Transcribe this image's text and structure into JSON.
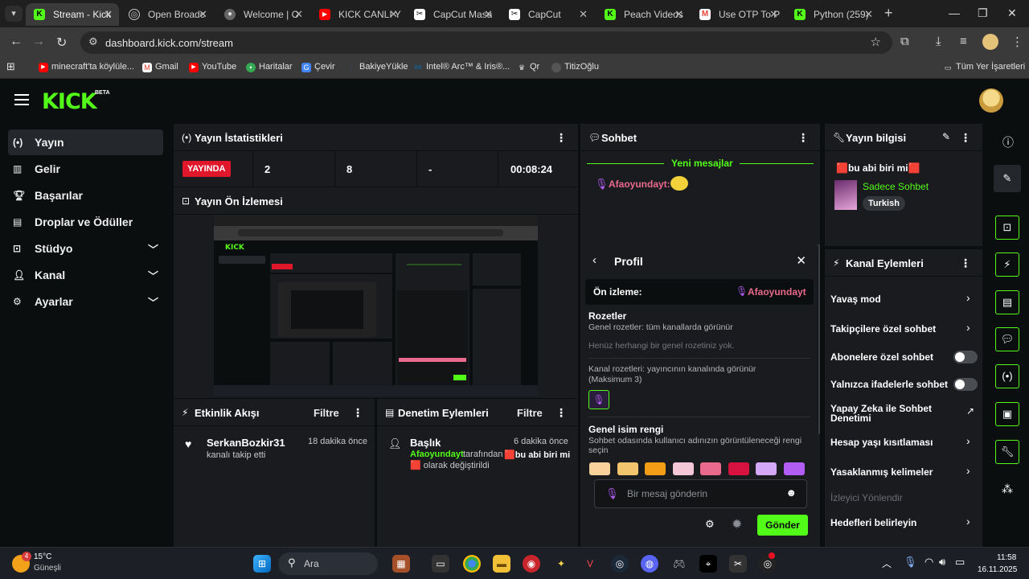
{
  "browser": {
    "tabs": [
      {
        "label": "Stream - Kick",
        "active": true,
        "icon": "kick-icon",
        "color": "#53fc18"
      },
      {
        "label": "Open Broadc",
        "active": false,
        "icon": "obs-icon",
        "color": "#cccccc"
      },
      {
        "label": "Welcome | O",
        "active": false,
        "icon": "globe-icon",
        "color": "#cccccc"
      },
      {
        "label": "KICK CANLI Y",
        "active": false,
        "icon": "youtube-icon",
        "color": "#ff0000"
      },
      {
        "label": "CapCut Masa",
        "active": false,
        "icon": "capcut-icon",
        "color": "#ffffff"
      },
      {
        "label": "CapCut",
        "active": false,
        "icon": "capcut-icon",
        "color": "#ffffff"
      },
      {
        "label": "Peach Videos",
        "active": false,
        "icon": "kick-icon",
        "color": "#53fc18"
      },
      {
        "label": "Use OTP To P",
        "active": false,
        "icon": "gmail-icon",
        "color": "#ea4335"
      },
      {
        "label": "Python (259)",
        "active": false,
        "icon": "kick-icon",
        "color": "#53fc18"
      }
    ],
    "url": "dashboard.kick.com/stream",
    "bookmarks": [
      {
        "label": "minecraft'ta köylüle...",
        "icon": "youtube-icon",
        "color": "#ff0000"
      },
      {
        "label": "Gmail",
        "icon": "gmail-icon",
        "color": "#ea4335"
      },
      {
        "label": "YouTube",
        "icon": "youtube-icon",
        "color": "#ff0000"
      },
      {
        "label": "Haritalar",
        "icon": "maps-icon",
        "color": "#34a853"
      },
      {
        "label": "Çevir",
        "icon": "translate-icon",
        "color": "#4285f4"
      },
      {
        "label": "BakiyeYükle",
        "icon": "bakiye-icon",
        "color": "#3d5afe"
      },
      {
        "label": "Intel® Arc™ & Iris®...",
        "icon": "intel-icon",
        "color": "#0071c5"
      },
      {
        "label": "Qr",
        "icon": "crown-icon",
        "color": "#dddddd"
      },
      {
        "label": "TitizOğlu",
        "icon": "globe-icon",
        "color": "#888888"
      }
    ],
    "all_bookmarks": "Tüm Yer İşaretleri"
  },
  "kick": {
    "logo": "KICK",
    "beta": "BETA",
    "nav": [
      {
        "label": "Yayın",
        "icon": "broadcast-icon",
        "active": true,
        "chevron": false
      },
      {
        "label": "Gelir",
        "icon": "chart-icon",
        "active": false,
        "chevron": false
      },
      {
        "label": "Başarılar",
        "icon": "trophy-icon",
        "active": false,
        "chevron": false
      },
      {
        "label": "Droplar ve Ödüller",
        "icon": "gift-icon",
        "active": false,
        "chevron": false
      },
      {
        "label": "Stüdyo",
        "icon": "studio-icon",
        "active": false,
        "chevron": true
      },
      {
        "label": "Kanal",
        "icon": "person-icon",
        "active": false,
        "chevron": true
      },
      {
        "label": "Ayarlar",
        "icon": "gear-icon",
        "active": false,
        "chevron": true
      }
    ],
    "stats": {
      "title": "Yayın İstatistikleri",
      "live": "YAYINDA",
      "viewers": "2",
      "followers": "8",
      "subs": "-",
      "duration": "00:08:24"
    },
    "preview": {
      "title": "Yayın Ön İzlemesi"
    },
    "activity": {
      "title": "Etkinlik Akışı",
      "filter": "Filtre",
      "items": [
        {
          "name": "SerkanBozkir31",
          "text": "kanalı takip etti",
          "time": "18 dakika önce"
        }
      ]
    },
    "moderation": {
      "title": "Denetim Eylemleri",
      "filter": "Filtre",
      "items": [
        {
          "title": "Başlık",
          "time": "6 dakika önce",
          "user": "Afaoyundayt",
          "text1": "tarafından",
          "value": "🟥bu abi biri mi",
          "text2": "🟥 olarak değiştirildi"
        }
      ]
    },
    "chat": {
      "title": "Sohbet",
      "new_messages": "Yeni mesajlar",
      "message_user": "Afaoyundayt:",
      "input_placeholder": "Bir mesaj gönderin",
      "send": "Gönder",
      "profile": {
        "title": "Profil",
        "preview_label": "Ön izleme:",
        "preview_name": "Afaoyundayt",
        "badges_title": "Rozetler",
        "global_badges": "Genel rozetler: tüm kanallarda görünür",
        "no_global": "Henüz herhangi bir genel rozetiniz yok.",
        "channel_badges": "Kanal rozetleri: yayıncının kanalında görünür",
        "channel_max": "(Maksimum 3)",
        "name_color_title": "Genel isim rengi",
        "name_color_desc1": "Sohbet odasında kullanıcı adınızın görüntüleneceği rengi",
        "name_color_desc2": "seçin",
        "swatches": [
          "#f9d29b",
          "#f2c46d",
          "#f29d15",
          "#f4c6d6",
          "#e96a8d",
          "#d8123e",
          "#d4a8f7",
          "#b15cf2"
        ]
      }
    },
    "info": {
      "title": "Yayın bilgisi",
      "stream_title": "🟥bu abi biri mi🟥",
      "category": "Sadece Sohbet",
      "language": "Turkish"
    },
    "channel_actions": {
      "title": "Kanal Eylemleri",
      "rows": [
        {
          "label": "Yavaş mod",
          "control": "arrow"
        },
        {
          "label": "Takipçilere özel sohbet",
          "control": "arrow"
        },
        {
          "label": "Abonelere özel sohbet",
          "control": "toggle"
        },
        {
          "label": "Yalnızca ifadelerle sohbet",
          "control": "toggle"
        },
        {
          "label": "Yapay Zeka ile Sohbet",
          "label2": "Denetimi",
          "control": "external"
        },
        {
          "label": "Hesap yaşı kısıtlaması",
          "control": "arrow"
        },
        {
          "label": "Yasaklanmış kelimeler",
          "control": "arrow"
        },
        {
          "label": "İzleyici Yönlendir",
          "control": "none",
          "muted": true
        },
        {
          "label": "Hedefleri belirleyin",
          "control": "arrow"
        }
      ]
    },
    "accent": "#53fc18"
  },
  "taskbar": {
    "weather_temp": "15°C",
    "weather_desc": "Güneşli",
    "weather_badge": "4",
    "search": "Ara",
    "time": "11:58",
    "date": "16.11.2025"
  }
}
